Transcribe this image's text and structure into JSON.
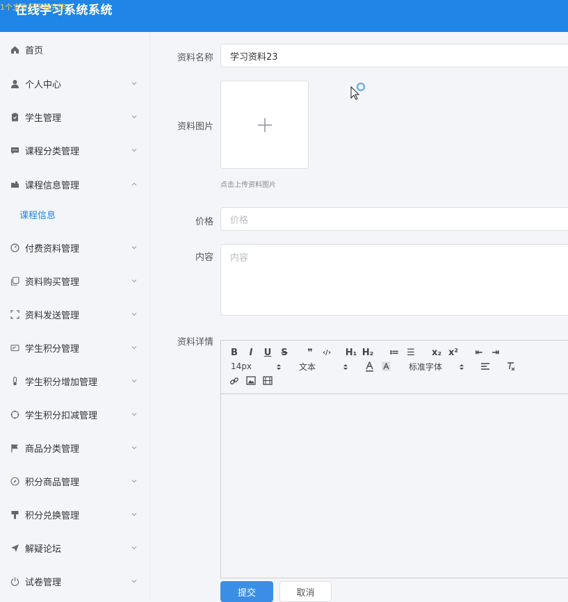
{
  "header": {
    "title": "在线学习系统系统",
    "overlay": "1个文件已下载完毕"
  },
  "sidebar": {
    "items": [
      {
        "label": "首页",
        "icon": "home-icon",
        "chevron": "none"
      },
      {
        "label": "个人中心",
        "icon": "user-icon",
        "chevron": "down"
      },
      {
        "label": "学生管理",
        "icon": "clipboard-icon",
        "chevron": "down"
      },
      {
        "label": "课程分类管理",
        "icon": "chat-icon",
        "chevron": "down"
      },
      {
        "label": "课程信息管理",
        "icon": "folder-icon",
        "chevron": "up"
      },
      {
        "label": "付费资料管理",
        "icon": "gauge-icon",
        "chevron": "down"
      },
      {
        "label": "资料购买管理",
        "icon": "copy-icon",
        "chevron": "down"
      },
      {
        "label": "资料发送管理",
        "icon": "frame-icon",
        "chevron": "down"
      },
      {
        "label": "学生积分管理",
        "icon": "card-icon",
        "chevron": "down"
      },
      {
        "label": "学生积分增加管理",
        "icon": "thermometer-icon",
        "chevron": "down"
      },
      {
        "label": "学生积分扣减管理",
        "icon": "target-icon",
        "chevron": "down"
      },
      {
        "label": "商品分类管理",
        "icon": "flag-icon",
        "chevron": "down"
      },
      {
        "label": "积分商品管理",
        "icon": "compass-icon",
        "chevron": "down"
      },
      {
        "label": "积分兑换管理",
        "icon": "brush-icon",
        "chevron": "down"
      },
      {
        "label": "解疑论坛",
        "icon": "send-icon",
        "chevron": "down"
      },
      {
        "label": "试卷管理",
        "icon": "power-icon",
        "chevron": "down"
      }
    ],
    "submenu": {
      "label": "课程信息"
    }
  },
  "form": {
    "name_label": "资料名称",
    "name_value": "学习资料23",
    "image_label": "资料图片",
    "upload_hint": "点击上传资料图片",
    "price_label": "价格",
    "price_placeholder": "价格",
    "content_label": "内容",
    "content_placeholder": "内容",
    "detail_label": "资料详情"
  },
  "editor": {
    "buttons": [
      "B",
      "I",
      "U",
      "S",
      "❞",
      "‹/›",
      "H₁",
      "H₂",
      "≔",
      "☰",
      "x₂",
      "x²",
      "⇤",
      "⇥"
    ],
    "font_size": "14px",
    "block_type": "文本",
    "font_family": "标准字体"
  },
  "actions": {
    "submit": "提交",
    "cancel": "取消"
  },
  "colors": {
    "header": "#1f85e6",
    "accent": "#3a8ee6",
    "background": "#f4f5f8"
  }
}
